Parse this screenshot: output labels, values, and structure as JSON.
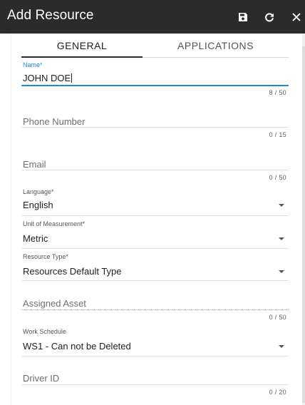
{
  "header": {
    "title": "Add Resource",
    "save_icon": "floppy-disk-icon",
    "refresh_icon": "refresh-icon",
    "close_icon": "close-icon"
  },
  "tabs": [
    {
      "label": "GENERAL",
      "active": true
    },
    {
      "label": "APPLICATIONS",
      "active": false
    }
  ],
  "fields": {
    "name": {
      "label": "Name",
      "required": "*",
      "value": "JOHN DOE",
      "counter": "8 / 50"
    },
    "phone": {
      "placeholder": "Phone Number",
      "counter": "0 / 15"
    },
    "email": {
      "placeholder": "Email",
      "counter": "0 / 50"
    },
    "language": {
      "label": "Language",
      "required": "*",
      "value": "English"
    },
    "unit": {
      "label": "Unit of Measurement",
      "required": "*",
      "value": "Metric"
    },
    "resource_type": {
      "label": "Resource Type",
      "required": "*",
      "value": "Resources Default Type"
    },
    "assigned_asset": {
      "placeholder": "Assigned Asset",
      "counter": "0 / 50"
    },
    "work_schedule": {
      "label": "Work Schedule",
      "value": "WS1 - Can not be Deleted"
    },
    "driver_id": {
      "placeholder": "Driver ID",
      "counter": "0 / 20"
    }
  },
  "colors": {
    "header_bg": "#2b2b2b",
    "accent": "#1e88e5"
  }
}
